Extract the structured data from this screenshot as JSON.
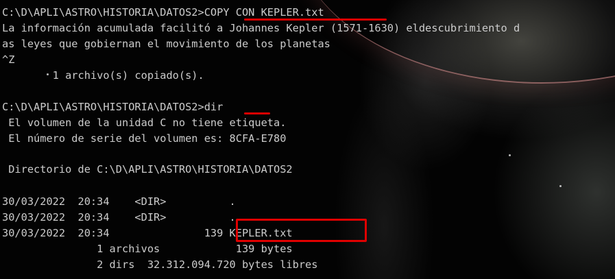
{
  "console": {
    "lines": [
      "C:\\D\\APLI\\ASTRO\\HISTORIA\\DATOS2>COPY CON KEPLER.txt",
      "La información acumulada facilitó a Johannes Kepler (1571-1630) eldescubrimiento d",
      "as leyes que gobiernan el movimiento de los planetas",
      "^Z",
      "        1 archivo(s) copiado(s).",
      "",
      "C:\\D\\APLI\\ASTRO\\HISTORIA\\DATOS2>dir",
      " El volumen de la unidad C no tiene etiqueta.",
      " El número de serie del volumen es: 8CFA-E780",
      "",
      " Directorio de C:\\D\\APLI\\ASTRO\\HISTORIA\\DATOS2",
      "",
      "30/03/2022  20:34    <DIR>          .",
      "30/03/2022  20:34    <DIR>          ..",
      "30/03/2022  20:34               139 KEPLER.txt",
      "               1 archivos            139 bytes",
      "               2 dirs  32.312.094.720 bytes libres"
    ]
  },
  "annotations": {
    "underline_color": "#e00000",
    "box_color": "#e00000"
  },
  "colors": {
    "text": "#cccccc",
    "background": "#000000"
  }
}
